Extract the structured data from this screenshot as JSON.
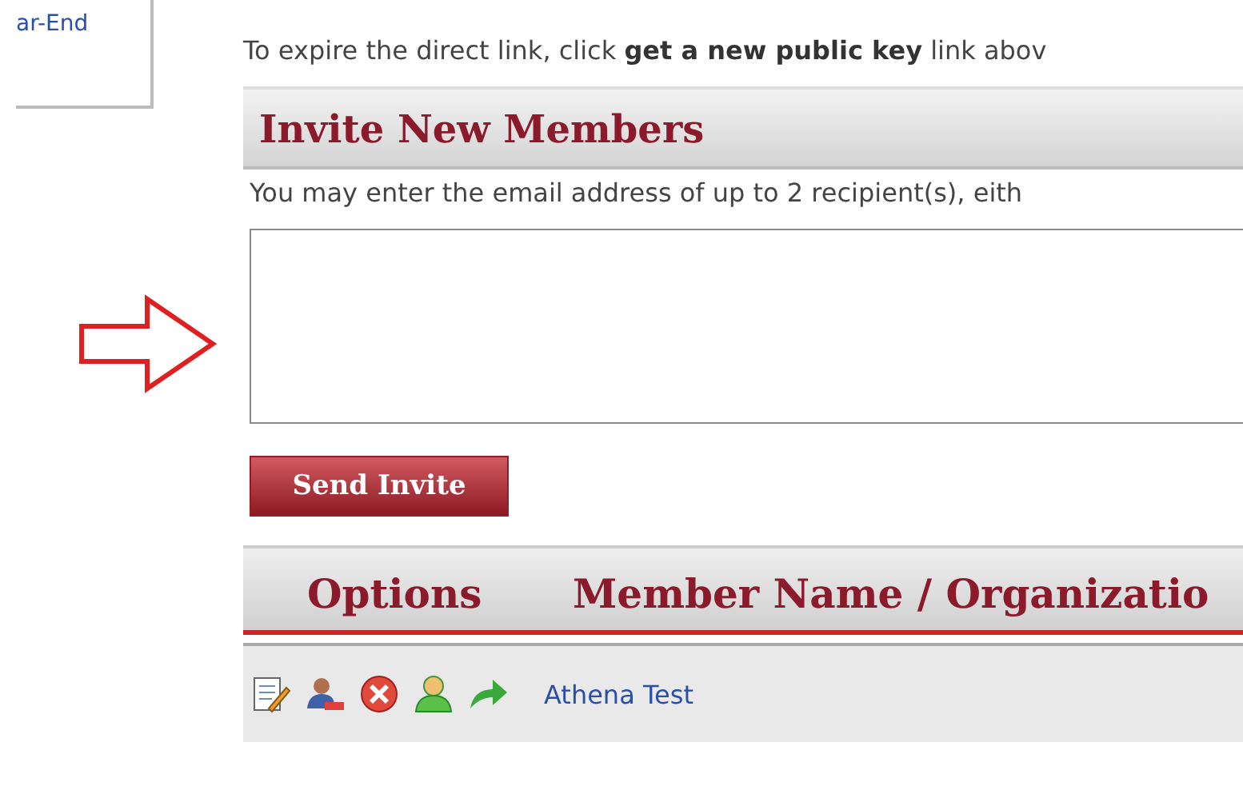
{
  "sidebar": {
    "link": "ar-End"
  },
  "expire_note": "To expire the direct link, click **get a new public key** link abov",
  "invite": {
    "title": "Invite New Members",
    "instructions": "You may enter the email address of up to 2 recipient(s), eith",
    "button": "Send Invite"
  },
  "table": {
    "columns": [
      "Options",
      "Member Name / Organizatio"
    ],
    "rows": [
      {
        "name": "Athena Test"
      }
    ]
  }
}
